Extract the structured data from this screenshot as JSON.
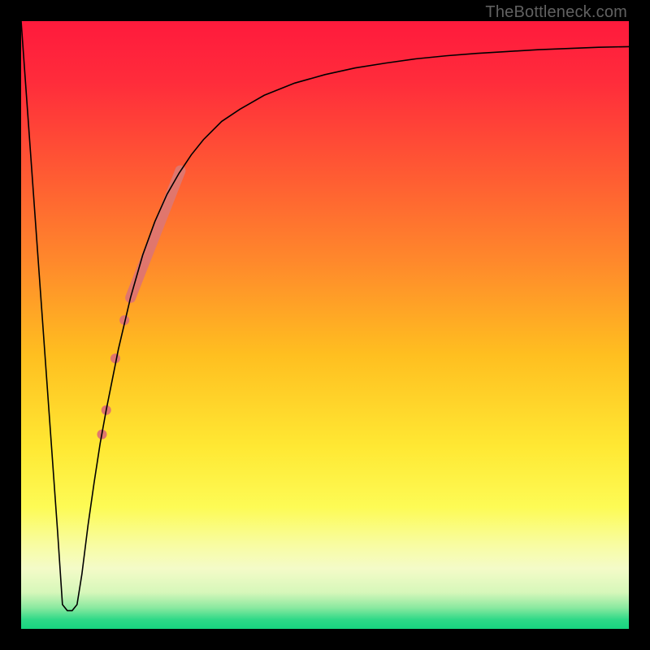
{
  "watermark": "TheBottleneck.com",
  "chart_data": {
    "type": "line",
    "title": "",
    "xlabel": "",
    "ylabel": "",
    "xlim": [
      0,
      100
    ],
    "ylim": [
      0,
      100
    ],
    "grid": false,
    "legend": false,
    "background_gradient_stops": [
      {
        "pos": 0.0,
        "color": "#ff1a3c"
      },
      {
        "pos": 0.1,
        "color": "#ff2c3b"
      },
      {
        "pos": 0.25,
        "color": "#ff5a33"
      },
      {
        "pos": 0.4,
        "color": "#ff8a2b"
      },
      {
        "pos": 0.55,
        "color": "#ffbf20"
      },
      {
        "pos": 0.7,
        "color": "#ffe833"
      },
      {
        "pos": 0.8,
        "color": "#fdfb55"
      },
      {
        "pos": 0.86,
        "color": "#f8fca0"
      },
      {
        "pos": 0.9,
        "color": "#f4fbc8"
      },
      {
        "pos": 0.94,
        "color": "#d7f7ba"
      },
      {
        "pos": 0.965,
        "color": "#8be9a0"
      },
      {
        "pos": 0.985,
        "color": "#2dd987"
      },
      {
        "pos": 1.0,
        "color": "#17d47f"
      }
    ],
    "series": [
      {
        "name": "bottleneck-curve",
        "color": "#000000",
        "stroke_width": 1.6,
        "x": [
          0.0,
          1.0,
          2.0,
          3.0,
          4.0,
          5.0,
          6.0,
          6.8,
          7.6,
          8.4,
          9.2,
          10.0,
          11.0,
          12.0,
          13.0,
          14.0,
          16.0,
          18.0,
          20.0,
          22.0,
          24.0,
          26.0,
          28.0,
          30.0,
          33.0,
          36.0,
          40.0,
          45.0,
          50.0,
          55.0,
          60.0,
          65.0,
          70.0,
          75.0,
          80.0,
          85.0,
          90.0,
          95.0,
          100.0
        ],
        "y": [
          100.0,
          86.0,
          72.0,
          58.0,
          44.0,
          30.0,
          16.0,
          4.0,
          3.0,
          3.0,
          4.0,
          9.0,
          17.0,
          24.0,
          30.5,
          36.0,
          46.0,
          54.5,
          61.5,
          67.0,
          71.5,
          75.0,
          78.0,
          80.5,
          83.5,
          85.5,
          87.8,
          89.8,
          91.2,
          92.3,
          93.1,
          93.8,
          94.3,
          94.7,
          95.0,
          95.3,
          95.5,
          95.7,
          95.8
        ]
      }
    ],
    "markers": [
      {
        "name": "salmon-highlight",
        "type": "thick-segment",
        "color": "#e0766d",
        "width": 13,
        "linecap": "round",
        "x": [
          18.0,
          26.2
        ],
        "y": [
          54.5,
          75.4
        ]
      },
      {
        "name": "salmon-dot-1",
        "type": "dot",
        "color": "#e0766d",
        "radius": 6.0,
        "x": 17.0,
        "y": 50.8
      },
      {
        "name": "salmon-dot-2",
        "type": "dot",
        "color": "#e0766d",
        "radius": 6.0,
        "x": 15.5,
        "y": 44.5
      },
      {
        "name": "salmon-dot-3",
        "type": "dot",
        "color": "#e0766d",
        "radius": 6.0,
        "x": 14.0,
        "y": 36.0
      },
      {
        "name": "salmon-dot-4",
        "type": "dot",
        "color": "#e0766d",
        "radius": 6.0,
        "x": 13.3,
        "y": 32.0
      }
    ]
  }
}
